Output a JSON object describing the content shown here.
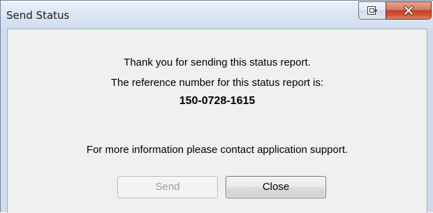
{
  "window": {
    "title": "Send Status"
  },
  "titlebar_buttons": {
    "restore_icon": "restore-icon",
    "close_icon": "close-icon",
    "close_color": "#c24328"
  },
  "dialog": {
    "thanks_text": "Thank you for sending this status report.",
    "reference_label": "The reference number for this status report is:",
    "reference_number": "150-0728-1615",
    "contact_text": "For more information please contact application support."
  },
  "buttons": {
    "send_label": "Send",
    "send_enabled": false,
    "close_label": "Close"
  }
}
